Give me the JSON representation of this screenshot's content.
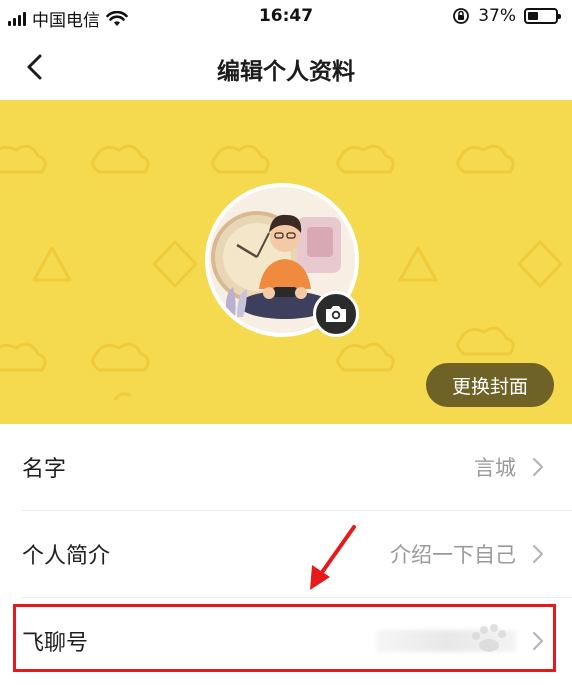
{
  "status_bar": {
    "carrier": "中国电信",
    "time": "16:47",
    "battery_percent_text": "37%",
    "battery_level": 0.37
  },
  "nav": {
    "title": "编辑个人资料",
    "back_icon": "chevron-left-icon"
  },
  "cover": {
    "background_color": "#f5d94e",
    "change_cover_label": "更换封面",
    "camera_icon": "camera-icon"
  },
  "profile_rows": [
    {
      "label": "名字",
      "value": "言城"
    },
    {
      "label": "个人简介",
      "value": "介绍一下自己"
    },
    {
      "label": "飞聊号",
      "value": ""
    }
  ],
  "annotation": {
    "highlight_color": "#e8191b"
  }
}
